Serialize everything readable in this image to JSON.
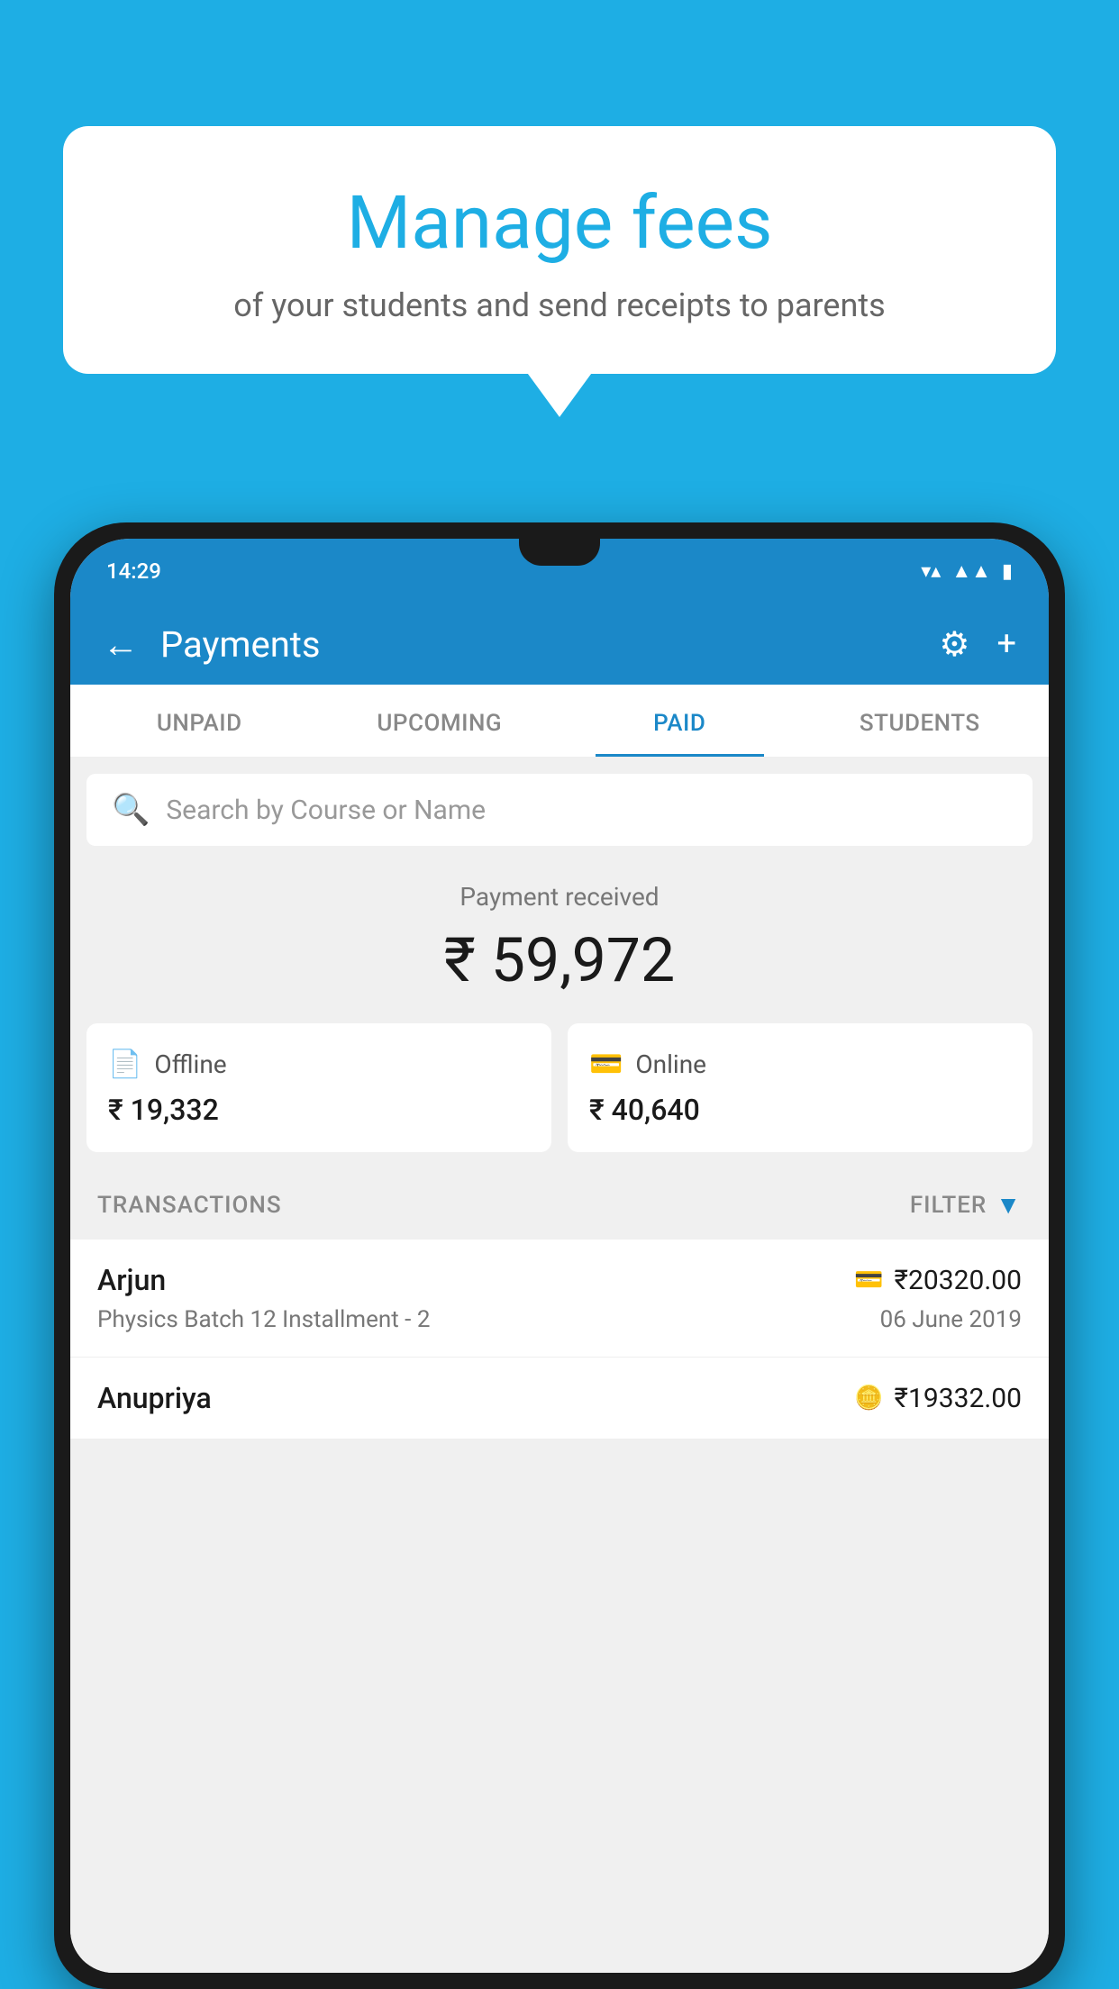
{
  "background_color": "#1EAEE4",
  "bubble": {
    "title": "Manage fees",
    "subtitle": "of your students and send receipts to parents"
  },
  "status_bar": {
    "time": "14:29"
  },
  "header": {
    "title": "Payments",
    "back_label": "←",
    "settings_icon": "⚙",
    "add_icon": "+"
  },
  "tabs": [
    {
      "label": "UNPAID",
      "active": false
    },
    {
      "label": "UPCOMING",
      "active": false
    },
    {
      "label": "PAID",
      "active": true
    },
    {
      "label": "STUDENTS",
      "active": false
    }
  ],
  "search": {
    "placeholder": "Search by Course or Name"
  },
  "payment": {
    "label": "Payment received",
    "amount": "₹ 59,972",
    "offline": {
      "label": "Offline",
      "amount": "₹ 19,332"
    },
    "online": {
      "label": "Online",
      "amount": "₹ 40,640"
    }
  },
  "transactions_label": "TRANSACTIONS",
  "filter_label": "FILTER",
  "transactions": [
    {
      "name": "Arjun",
      "type_icon": "💳",
      "amount": "₹20320.00",
      "course": "Physics Batch 12 Installment - 2",
      "date": "06 June 2019"
    },
    {
      "name": "Anupriya",
      "type_icon": "🪙",
      "amount": "₹19332.00",
      "course": "",
      "date": ""
    }
  ]
}
